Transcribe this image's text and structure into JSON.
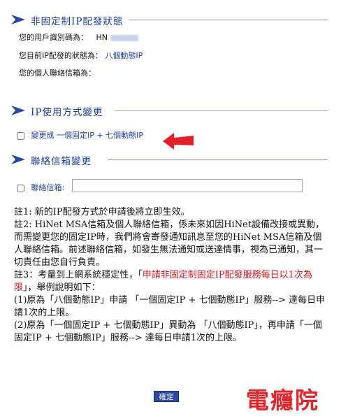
{
  "section1": {
    "title": "非固定制IP配發狀態",
    "user_id_label": "您的用戶識別碼為：",
    "user_id_value": "HN",
    "status_label": "您目前IP配發的狀態為：",
    "status_value": "八個動態IP",
    "email_label": "您的個人聯絡信箱為："
  },
  "section2": {
    "title": "IP使用方式變更",
    "option_prefix": "變更成",
    "option_value": "一個固定IP + 七個動態IP"
  },
  "section3": {
    "title": "聯絡信箱變更",
    "email_label": "聯絡信箱:",
    "email_value": ""
  },
  "notes": {
    "note1": "註1: 新的IP配發方式於申請後將立即生效。",
    "note2": "註2: HiNet MSA信箱及個人聯絡信箱，係未來如因HiNet設備改接或異動，而需變更您的固定IP時，我們將會寄發通知訊息至您的HiNet MSA信箱及個人聯絡信箱。前述聯絡信箱，如發生無法通知或送達情事，視為已通知，其一切責任由您自行負責。",
    "note3_prefix": "註3：考量到上網系統穩定性，「",
    "note3_red": "申請非固定制固定IP配發服務每日以1次為限",
    "note3_suffix": "」，舉例說明如下：",
    "ex1": "(1)原為「八個動態IP」申請 「一個固定IP + 七個動態IP」服務--> 達每日申請1次的上限。",
    "ex2": "(2)原為「一個固定IP + 七個動態IP」異動為 「八個動態IP」，再申請「一個固定IP + 七個動態IP」服務--> 達每日申請1次的上限。"
  },
  "buttons": {
    "ok": "確定"
  },
  "watermark": "電癮院",
  "colors": {
    "accent": "#1a3c8c",
    "warning": "#c8161e",
    "arrow": "#e3202a"
  }
}
